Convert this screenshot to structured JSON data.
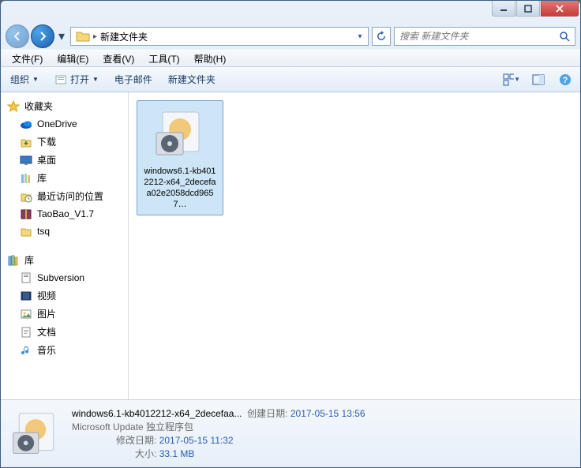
{
  "window": {
    "path_crumb": "新建文件夹",
    "search_placeholder": "搜索 新建文件夹"
  },
  "menubar": {
    "file": "文件(F)",
    "edit": "编辑(E)",
    "view": "查看(V)",
    "tools": "工具(T)",
    "help": "帮助(H)"
  },
  "toolbar": {
    "organize": "组织",
    "open": "打开",
    "email": "电子邮件",
    "new_folder": "新建文件夹"
  },
  "sidebar": {
    "favorites_label": "收藏夹",
    "favorites": [
      {
        "label": "OneDrive",
        "icon": "onedrive"
      },
      {
        "label": "下载",
        "icon": "download"
      },
      {
        "label": "桌面",
        "icon": "desktop"
      },
      {
        "label": "库",
        "icon": "library"
      },
      {
        "label": "最近访问的位置",
        "icon": "recent"
      },
      {
        "label": "TaoBao_V1.7",
        "icon": "archive"
      },
      {
        "label": "tsq",
        "icon": "folder"
      }
    ],
    "libraries_label": "库",
    "libraries": [
      {
        "label": "Subversion",
        "icon": "svn"
      },
      {
        "label": "视频",
        "icon": "video"
      },
      {
        "label": "图片",
        "icon": "picture"
      },
      {
        "label": "文档",
        "icon": "document"
      },
      {
        "label": "音乐",
        "icon": "music"
      }
    ]
  },
  "files": [
    {
      "name": "windows6.1-kb4012212-x64_2decefaa02e2058dcd9657…"
    }
  ],
  "details": {
    "filename": "windows6.1-kb4012212-x64_2decefaa...",
    "type": "Microsoft Update 独立程序包",
    "created_label": "创建日期:",
    "created_value": "2017-05-15 13:56",
    "modified_label": "修改日期:",
    "modified_value": "2017-05-15 11:32",
    "size_label": "大小:",
    "size_value": "33.1 MB"
  }
}
